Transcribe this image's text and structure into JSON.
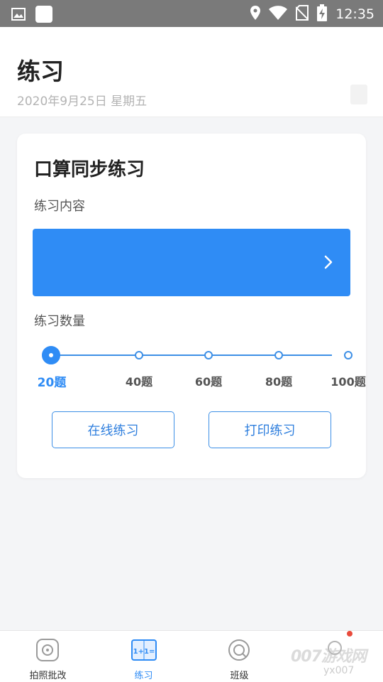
{
  "status_bar": {
    "time": "12:35"
  },
  "header": {
    "title": "练习",
    "date": "2020年9月25日 星期五"
  },
  "card": {
    "title": "口算同步练习",
    "content_label": "练习内容",
    "content_value": "",
    "quantity_label": "练习数量",
    "quantity_options": [
      "20题",
      "40题",
      "60题",
      "80题",
      "100题"
    ],
    "quantity_selected": "20题",
    "buttons": {
      "online": "在线练习",
      "print": "打印练习"
    }
  },
  "colors": {
    "accent": "#2f8cf5",
    "status_bar": "#7a7a7a"
  },
  "bottom_nav": {
    "items": [
      {
        "label": "拍照批改",
        "icon": "camera-icon"
      },
      {
        "label": "练习",
        "icon": "exercise-book-icon",
        "active": true
      },
      {
        "label": "班级",
        "icon": "class-icon"
      },
      {
        "label": "",
        "icon": "profile-icon"
      }
    ]
  },
  "watermark": {
    "text": "007游戏网",
    "sub": "yx007"
  }
}
